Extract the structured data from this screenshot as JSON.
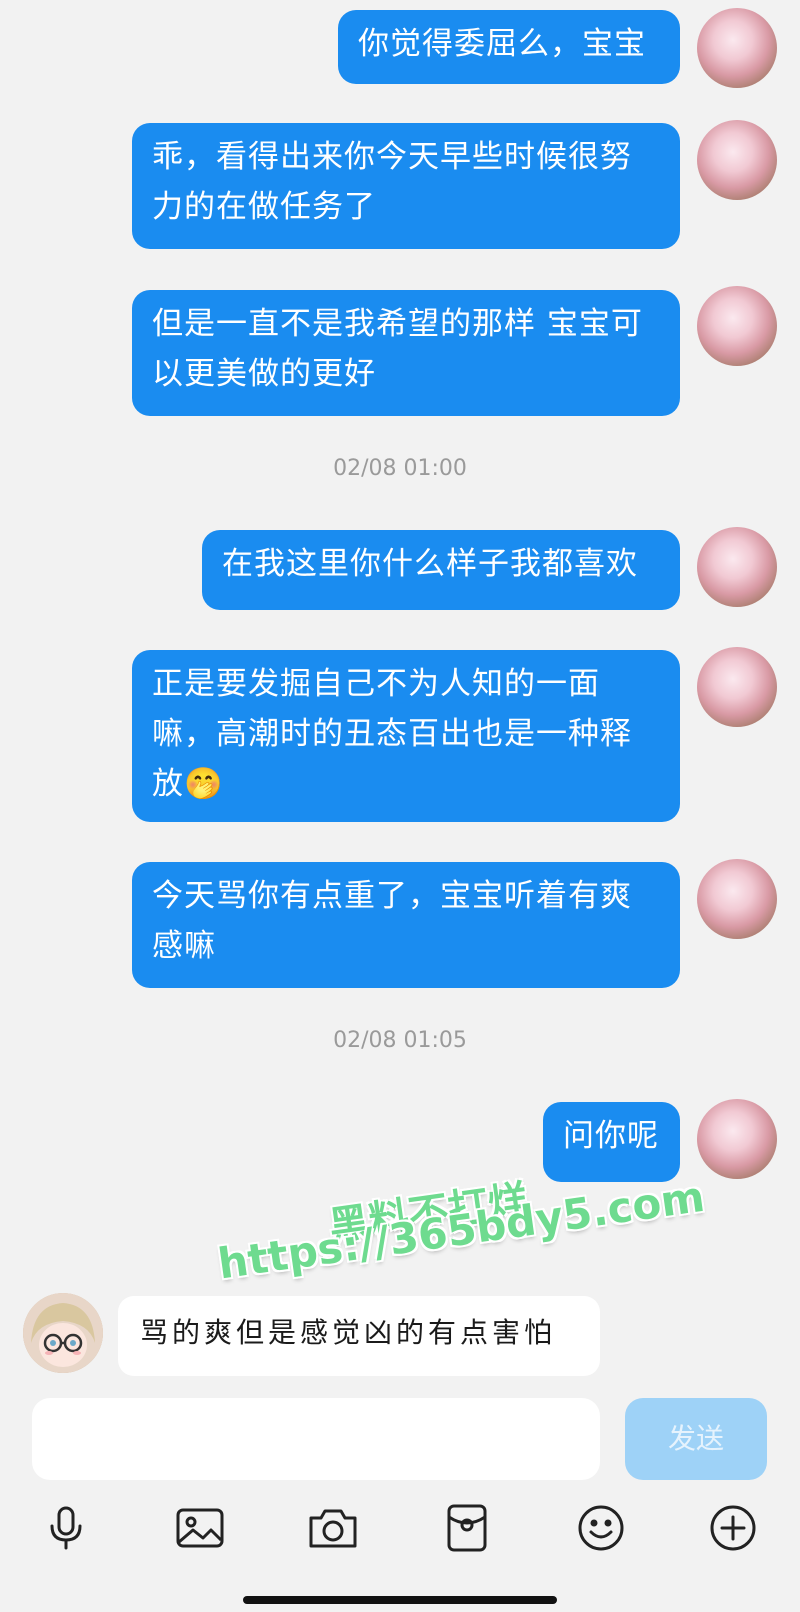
{
  "messages_out": [
    {
      "text": "你觉得委屈么，宝宝"
    },
    {
      "text": "乖，看得出来你今天早些时候很努力的在做任务了"
    },
    {
      "text": "但是一直不是我希望的那样 宝宝可以更美做的更好"
    },
    {
      "text": "在我这里你什么样子我都喜欢"
    },
    {
      "text": "正是要发掘自己不为人知的一面嘛，高潮时的丑态百出也是一种释放🤭"
    },
    {
      "text": "今天骂你有点重了，宝宝听着有爽感嘛"
    },
    {
      "text": "问你呢"
    }
  ],
  "timestamps": [
    "02/08 01:00",
    "02/08 01:05"
  ],
  "message_in": {
    "text": "骂的爽但是感觉凶的有点害怕"
  },
  "watermark": {
    "line1": "黑料不打烊",
    "line2": "https://365bdy5.com"
  },
  "composer": {
    "input_value": "",
    "send_label": "发送"
  },
  "toolbar_icons": [
    "microphone-icon",
    "image-icon",
    "camera-icon",
    "red-packet-icon",
    "emoji-icon",
    "plus-icon"
  ],
  "colors": {
    "outgoing_bubble": "#1a8cf0",
    "send_button": "#9ed2f7",
    "watermark": "#6edb8f"
  }
}
